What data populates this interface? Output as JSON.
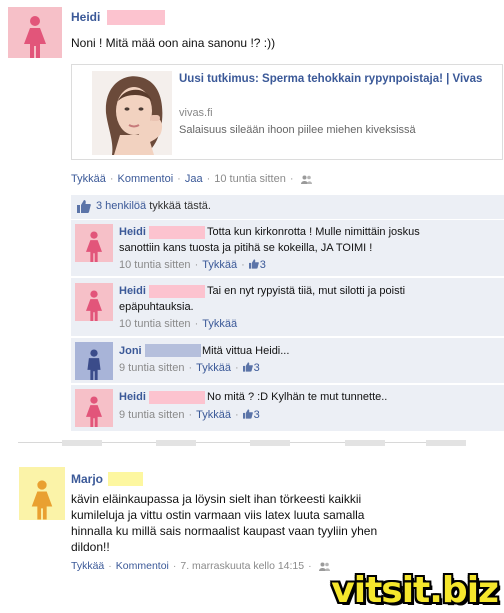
{
  "post": {
    "author": "Heidi",
    "text": "Noni ! Mitä mää oon aina sanonu !? :))",
    "link": {
      "title": "Uusi tutkimus: Sperma tehokkain rypynpoistaja! | Vivas",
      "domain": "vivas.fi",
      "description": "Salaisuus sileään ihoon piilee miehen kiveksissä"
    },
    "actions": {
      "like": "Tykkää",
      "comment": "Kommentoi",
      "share": "Jaa",
      "time": "10 tuntia sitten"
    },
    "likes_summary": {
      "count_text": "3 henkilöä",
      "suffix": "tykkää tästä."
    }
  },
  "comments": [
    {
      "author": "Heidi",
      "text_line1": "Totta kun kirkonrotta ! Mulle nimittäin joskus",
      "text_line2": "sanottiin kans tuosta ja pitihä se kokeilla, JA TOIMI !",
      "time": "10 tuntia sitten",
      "like": "Tykkää",
      "likes": "3"
    },
    {
      "author": "Heidi",
      "text_line1": "Tai en nyt rypyistä tiiä, mut silotti ja poisti",
      "text_line2": "epäpuhtauksia.",
      "time": "10 tuntia sitten",
      "like": "Tykkää",
      "likes": ""
    },
    {
      "author": "Joni",
      "text_line1": "Mitä vittua Heidi...",
      "text_line2": "",
      "time": "9 tuntia sitten",
      "like": "Tykkää",
      "likes": "3"
    },
    {
      "author": "Heidi",
      "text_line1": "No mitä ? :D Kylhän te mut tunnette..",
      "text_line2": "",
      "time": "9 tuntia sitten",
      "like": "Tykkää",
      "likes": "3"
    }
  ],
  "post2": {
    "author": "Marjo",
    "text": "kävin eläinkaupassa ja löysin sielt ihan törkeesti kaikkii kumileluja ja vittu ostin varmaan viis latex luuta samalla hinnalla ku millä sais normaalist kaupast vaan tyyliin yhen dildon!!",
    "actions": {
      "like": "Tykkää",
      "comment": "Kommentoi",
      "time": "7. marraskuuta kello 14:15"
    }
  },
  "watermark": "vitsit.biz",
  "colors": {
    "link_blue": "#3b5998",
    "comment_bg": "#eceff5",
    "female_avatar": "#f6c0c8",
    "male_avatar": "#a8b4d8",
    "marjo_avatar": "#fbf3a8",
    "watermark": "#f5e62c"
  }
}
